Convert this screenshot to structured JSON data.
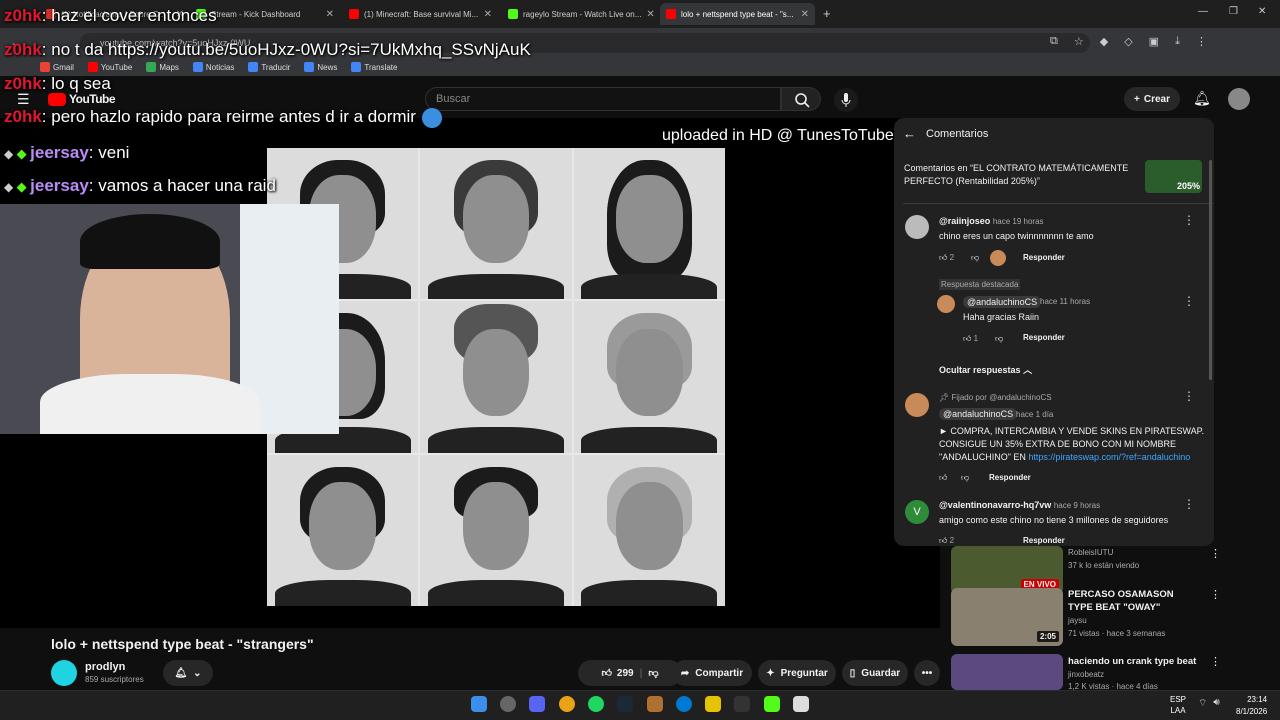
{
  "browser": {
    "tabs": [
      {
        "label": "(1) Notificaciones | Sobre C...",
        "fav": "#d93025"
      },
      {
        "label": "Stream - Kick Dashboard",
        "fav": "#53fc18"
      },
      {
        "label": "(1) Minecraft: Base survival Mi...",
        "fav": "#ff0000"
      },
      {
        "label": "rageylo Stream - Watch Live on...",
        "fav": "#53fc18"
      },
      {
        "label": "lolo + nettspend type beat - \"s...",
        "fav": "#ff0000"
      }
    ],
    "url": "youtube.com/watch?v=5uoHJxz-0WU",
    "bookmarks": [
      "Gmail",
      "YouTube",
      "Maps",
      "Noticias",
      "Traducir",
      "News",
      "Translate"
    ]
  },
  "youtube": {
    "logo": "YouTube",
    "search_placeholder": "Buscar",
    "create_label": "Crear"
  },
  "chat": [
    {
      "user": "z0hk",
      "text": ": haz el cover entonces",
      "color": "#e0182f"
    },
    {
      "user": "z0hk",
      "text": ": no t da https://youtu.be/5uoHJxz-0WU?si=7UkMxhq_SSvNjAuK",
      "color": "#e0182f"
    },
    {
      "user": "z0hk",
      "text": ": lo q sea",
      "color": "#e0182f"
    },
    {
      "user": "z0hk",
      "text": ": pero hazlo rapido para reirme antes d ir a dormir",
      "color": "#e0182f"
    },
    {
      "user": "jeersay",
      "text": ": veni",
      "color": "#b98cf5"
    },
    {
      "user": "jeersay",
      "text": ": vamos a hacer una raid",
      "color": "#b98cf5"
    }
  ],
  "video": {
    "watermark": "uploaded in HD @ TunesToTube",
    "title": "lolo + nettspend type beat - \"strangers\"",
    "channel": "prodlyn",
    "subscribers": "859 suscriptores",
    "likes": "299",
    "share": "Compartir",
    "ask": "Preguntar",
    "save": "Guardar"
  },
  "comments": {
    "header": "Comentarios",
    "context": "Comentarios en “EL CONTRATO MATEMÁTICAMENTE PERFECTO (Rentabilidad 205%)”",
    "thumb_badge": "205%",
    "items": [
      {
        "author": "@raiinjoseo",
        "time": "hace 19 horas",
        "text": "chino eres un capo twinnnnnnn te amo",
        "likes": "2",
        "reply": "Responder"
      },
      {
        "author": "@valentinonavarro-hq7vw",
        "time": "hace 9 horas",
        "text": "amigo como este chino no tiene 3 millones de seguidores",
        "likes": "2",
        "reply": "Responder"
      }
    ],
    "featured_reply_label": "Respuesta destacada",
    "reply": {
      "author": "@andaluchinoCS",
      "time": "hace 11 horas",
      "text": "Haha gracias Raiin",
      "likes": "1",
      "reply": "Responder"
    },
    "hide_replies": "Ocultar respuestas",
    "pinned": {
      "pinned_by": "Fijado por @andaluchinoCS",
      "author": "@andaluchinoCS",
      "time": "hace 1 día",
      "text1": "► COMPRA, INTERCAMBIA Y VENDE SKINS EN PIRATESWAP.",
      "text2": "CONSIGUE UN 35% EXTRA DE BONO CON MI NOMBRE",
      "text3": "\"ANDALUCHINO\" EN",
      "link": "https://pirateswap.com/?ref=andaluchino",
      "reply": "Responder"
    }
  },
  "suggestions": [
    {
      "title": "",
      "channel": "RobleisIUTU",
      "meta": "37 k lo están viendo",
      "badge": "EN VIVO"
    },
    {
      "title": "PERCASO OSAMASON TYPE BEAT \"OWAY\"",
      "channel": "jaysu",
      "meta": "71 vistas · hace 3 semanas",
      "duration": "2:05"
    },
    {
      "title": "haciendo un crank type beat",
      "channel": "jinxobeatz",
      "meta": "1,2 K vistas · hace 4 días"
    }
  ],
  "taskbar": {
    "lang1": "ESP",
    "lang2": "LAA",
    "time": "23:14",
    "date": "8/1/2026"
  },
  "colors": {
    "accent": "#3ea6ff",
    "youtube_red": "#ff0000"
  }
}
